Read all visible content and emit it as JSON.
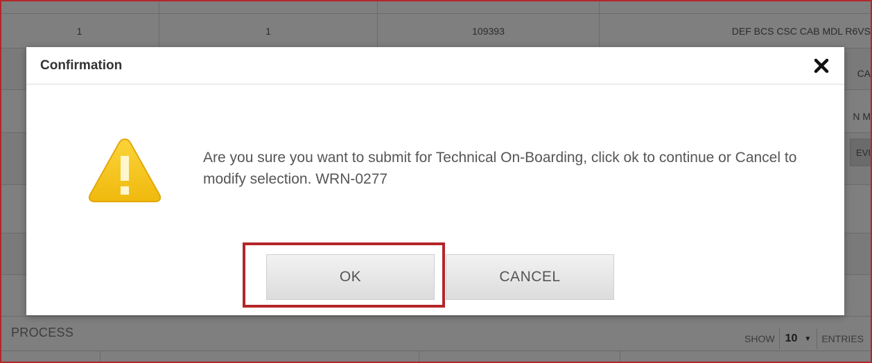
{
  "background": {
    "rows": [
      {
        "col1": "",
        "col2": "",
        "col3": "",
        "col4": ""
      },
      {
        "col1": "1",
        "col2": "1",
        "col3": "109393",
        "col4": "DEF BCS CSC CAB MDL R6VS"
      }
    ],
    "right_fragments": [
      "CA",
      "N M",
      "EVI"
    ],
    "section_label": "PROCESS",
    "show_label": "SHOW",
    "show_value": "10",
    "entries_label": "ENTRIES"
  },
  "dialog": {
    "title": "Confirmation",
    "close_icon": "close-icon",
    "warning_icon": "warning-triangle-icon",
    "message": "Are you sure you want to submit for Technical On-Boarding, click ok to continue or Cancel to modify selection. WRN-0277",
    "ok_label": "OK",
    "cancel_label": "CANCEL"
  },
  "colors": {
    "highlight": "#b3262a",
    "warning": "#f5c518"
  }
}
